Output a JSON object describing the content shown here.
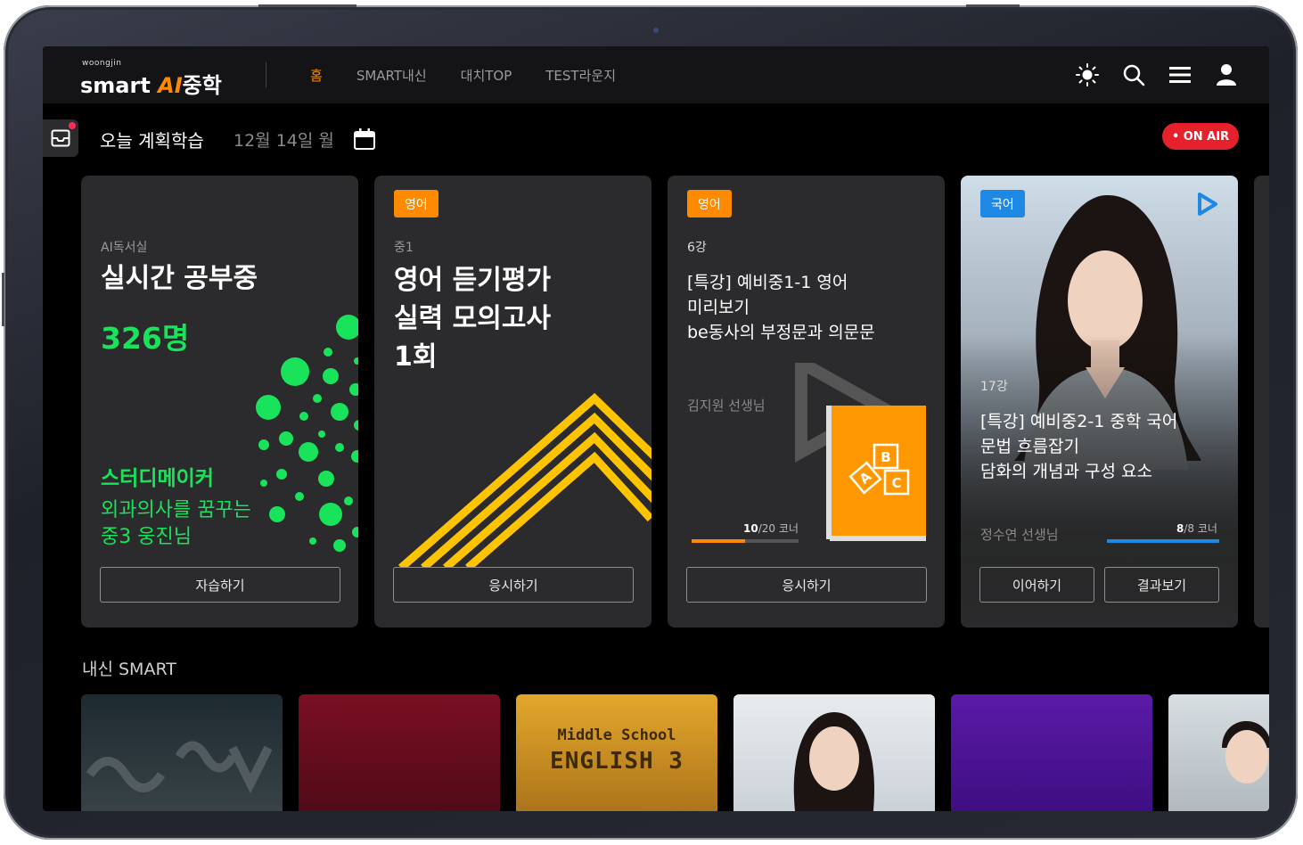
{
  "header": {
    "logo_small": "woongjin",
    "logo_smart": "smart",
    "logo_ai": "AI",
    "logo_school": "중학",
    "tabs": [
      {
        "label": "홈",
        "active": true
      },
      {
        "label": "SMART내신",
        "active": false
      },
      {
        "label": "대치TOP",
        "active": false
      },
      {
        "label": "TEST라운지",
        "active": false
      }
    ],
    "icons": [
      "brightness-icon",
      "search-icon",
      "menu-icon",
      "user-icon"
    ]
  },
  "plan": {
    "title": "오늘 계획학습",
    "date": "12월 14일 월",
    "onair": "• ON AIR"
  },
  "cards": [
    {
      "sub": "AI독서실",
      "title": "실시간 공부중",
      "count": "326명",
      "maker_title": "스터디메이커",
      "maker_line1": "외과의사를 꿈꾸는",
      "maker_line2": "중3 웅진님",
      "button": "자습하기"
    },
    {
      "tag": "영어",
      "sub": "중1",
      "title_lines": [
        "영어 듣기평가",
        "실력 모의고사",
        "1회"
      ],
      "button": "응시하기"
    },
    {
      "tag": "영어",
      "sub": "6강",
      "title_lines": [
        "[특강] 예비중1-1 영어",
        "미리보기",
        "be동사의 부정문과 의문문"
      ],
      "teacher": "김지원 선생님",
      "progress_done": "10",
      "progress_total": "/20 코너",
      "progress_fraction": 0.5,
      "button": "응시하기"
    },
    {
      "tag": "국어",
      "sub": "17강",
      "title_lines": [
        "[특강] 예비중2-1 중학 국어",
        "문법 흐름잡기",
        "담화의 개념과 구성 요소"
      ],
      "teacher": "정수연 선생님",
      "progress_done": "8",
      "progress_total": "/8 코너",
      "progress_fraction": 1.0,
      "button_left": "이어하기",
      "button_right": "결과보기"
    }
  ],
  "section": {
    "title": "내신 SMART",
    "book_line1": "Middle School",
    "book_line2": "ENGLISH 3"
  },
  "colors": {
    "accent": "#ff8a00",
    "green": "#19e35a",
    "blue": "#1e88e5",
    "onair": "#e5212c"
  }
}
